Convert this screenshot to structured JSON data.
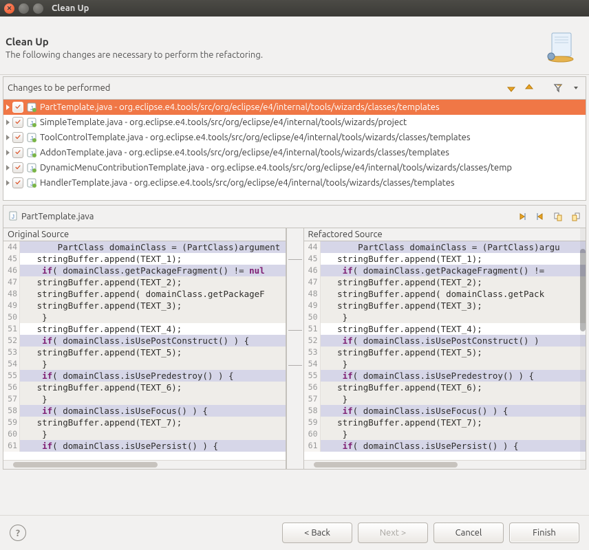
{
  "window": {
    "title": "Clean Up"
  },
  "header": {
    "title": "Clean Up",
    "subtitle": "The following changes are necessary to perform the refactoring."
  },
  "changes_section": {
    "title": "Changes to be performed"
  },
  "toolbar_icons": {
    "next_change": "next-change-icon",
    "prev_change": "prev-change-icon",
    "filter": "filter-icon",
    "dropdown": "dropdown-icon"
  },
  "tree": [
    {
      "label": "PartTemplate.java - org.eclipse.e4.tools/src/org/eclipse/e4/internal/tools/wizards/classes/templates",
      "checked": true,
      "selected": true
    },
    {
      "label": "SimpleTemplate.java - org.eclipse.e4.tools/src/org/eclipse/e4/internal/tools/wizards/project",
      "checked": true,
      "selected": false
    },
    {
      "label": "ToolControlTemplate.java - org.eclipse.e4.tools/src/org/eclipse/e4/internal/tools/wizards/classes/templates",
      "checked": true,
      "selected": false
    },
    {
      "label": "AddonTemplate.java - org.eclipse.e4.tools/src/org/eclipse/e4/internal/tools/wizards/classes/templates",
      "checked": true,
      "selected": false
    },
    {
      "label": "DynamicMenuContributionTemplate.java - org.eclipse.e4.tools/src/org/eclipse/e4/internal/tools/wizards/classes/temp",
      "checked": true,
      "selected": false
    },
    {
      "label": "HandlerTemplate.java - org.eclipse.e4.tools/src/org/eclipse/e4/internal/tools/wizards/classes/templates",
      "checked": true,
      "selected": false
    }
  ],
  "file_tab": {
    "file": "PartTemplate.java",
    "icons": {
      "next_diff": "next-diff-icon",
      "prev_diff": "prev-diff-icon",
      "copy_left": "copy-left-icon",
      "copy_right": "copy-right-icon"
    }
  },
  "diff": {
    "left_title": "Original Source",
    "right_title": "Refactored Source",
    "left": [
      {
        "n": 44,
        "pre": "       PartClass domainClass = (PartClass)argument",
        "hl": true
      },
      {
        "n": 45,
        "pre": "   stringBuffer.append(TEXT_1);"
      },
      {
        "n": 46,
        "pre": "    ",
        "kw": "if",
        "post": "( domainClass.getPackageFragment() != ",
        "kw2": "nul",
        "hl": true
      },
      {
        "n": 47,
        "pre": "   stringBuffer.append(TEXT_2);",
        "shaded": true
      },
      {
        "n": 48,
        "pre": "   stringBuffer.append( domainClass.getPackageF",
        "shaded": true
      },
      {
        "n": 49,
        "pre": "   stringBuffer.append(TEXT_3);",
        "shaded": true
      },
      {
        "n": 50,
        "pre": "    }",
        "shaded": true
      },
      {
        "n": 51,
        "pre": "   stringBuffer.append(TEXT_4);"
      },
      {
        "n": 52,
        "pre": "    ",
        "kw": "if",
        "post": "( domainClass.isUsePostConstruct() ) {",
        "hl": true
      },
      {
        "n": 53,
        "pre": "   stringBuffer.append(TEXT_5);",
        "shaded": true
      },
      {
        "n": 54,
        "pre": "    }",
        "shaded": true
      },
      {
        "n": 55,
        "pre": "    ",
        "kw": "if",
        "post": "( domainClass.isUsePredestroy() ) {",
        "hl": true
      },
      {
        "n": 56,
        "pre": "   stringBuffer.append(TEXT_6);",
        "shaded": true
      },
      {
        "n": 57,
        "pre": "    }",
        "shaded": true
      },
      {
        "n": 58,
        "pre": "    ",
        "kw": "if",
        "post": "( domainClass.isUseFocus() ) {",
        "hl": true
      },
      {
        "n": 59,
        "pre": "   stringBuffer.append(TEXT_7);",
        "shaded": true
      },
      {
        "n": 60,
        "pre": "    }",
        "shaded": true
      },
      {
        "n": 61,
        "pre": "    ",
        "kw": "if",
        "post": "( domainClass.isUsePersist() ) {",
        "hl": true
      }
    ],
    "right": [
      {
        "n": 44,
        "pre": "       PartClass domainClass = (PartClass)argu",
        "hl": true
      },
      {
        "n": 45,
        "pre": "   stringBuffer.append(TEXT_1);"
      },
      {
        "n": 46,
        "pre": "    ",
        "kw": "if",
        "post": "( domainClass.getPackageFragment() !=",
        "hl": true
      },
      {
        "n": 47,
        "pre": "   stringBuffer.append(TEXT_2);",
        "shaded": true
      },
      {
        "n": 48,
        "pre": "   stringBuffer.append( domainClass.getPack",
        "shaded": true
      },
      {
        "n": 49,
        "pre": "   stringBuffer.append(TEXT_3);",
        "shaded": true
      },
      {
        "n": 50,
        "pre": "    }",
        "shaded": true
      },
      {
        "n": 51,
        "pre": "   stringBuffer.append(TEXT_4);"
      },
      {
        "n": 52,
        "pre": "    ",
        "kw": "if",
        "post": "( domainClass.isUsePostConstruct() ) ",
        "hl": true
      },
      {
        "n": 53,
        "pre": "   stringBuffer.append(TEXT_5);",
        "shaded": true
      },
      {
        "n": 54,
        "pre": "    }",
        "shaded": true
      },
      {
        "n": 55,
        "pre": "    ",
        "kw": "if",
        "post": "( domainClass.isUsePredestroy() ) {",
        "hl": true
      },
      {
        "n": 56,
        "pre": "   stringBuffer.append(TEXT_6);",
        "shaded": true
      },
      {
        "n": 57,
        "pre": "    }",
        "shaded": true
      },
      {
        "n": 58,
        "pre": "    ",
        "kw": "if",
        "post": "( domainClass.isUseFocus() ) {",
        "hl": true
      },
      {
        "n": 59,
        "pre": "   stringBuffer.append(TEXT_7);",
        "shaded": true
      },
      {
        "n": 60,
        "pre": "    }",
        "shaded": true
      },
      {
        "n": 61,
        "pre": "    ",
        "kw": "if",
        "post": "( domainClass.isUsePersist() ) {",
        "hl": true
      }
    ]
  },
  "buttons": {
    "back": "< Back",
    "next": "Next >",
    "cancel": "Cancel",
    "finish": "Finish"
  }
}
